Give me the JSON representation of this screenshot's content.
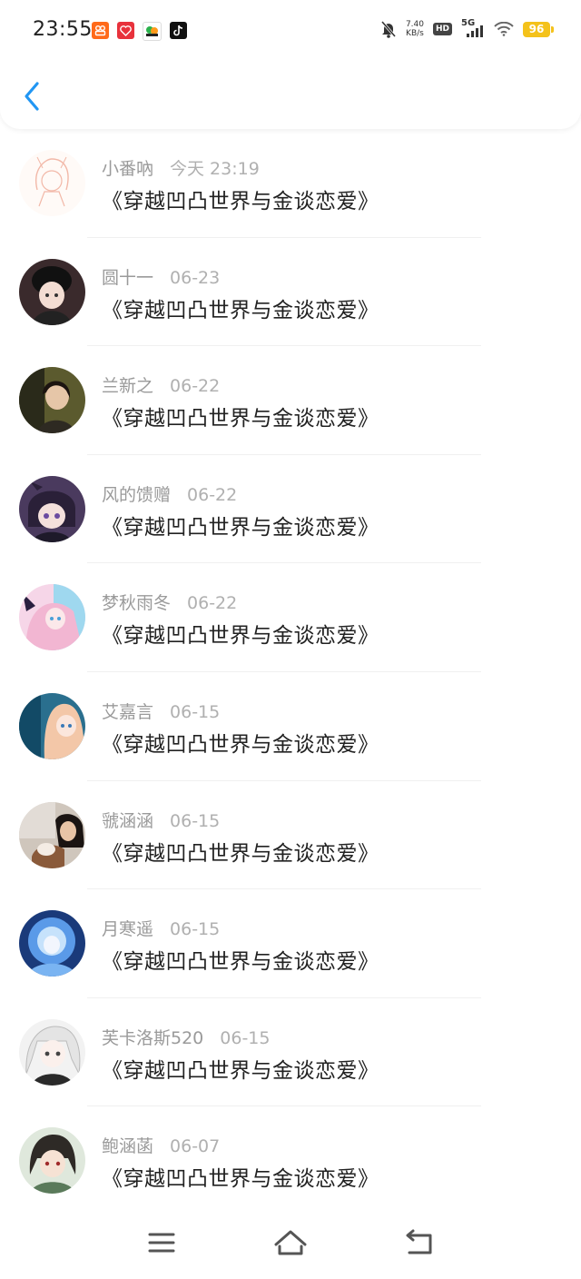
{
  "status_bar": {
    "time": "23:55",
    "net_speed_value": "7.40",
    "net_speed_unit": "KB/s",
    "hd": "HD",
    "network": "5G",
    "battery": "96"
  },
  "colors": {
    "accent": "#2196f3",
    "battery": "#f4c21b"
  },
  "messages": [
    {
      "name": "小番吶",
      "date": "今天 23:19",
      "text": "《穿越凹凸世界与金谈恋爱》"
    },
    {
      "name": "圆十一",
      "date": "06-23",
      "text": "《穿越凹凸世界与金谈恋爱》"
    },
    {
      "name": "兰新之",
      "date": "06-22",
      "text": "《穿越凹凸世界与金谈恋爱》"
    },
    {
      "name": "风的馈赠",
      "date": "06-22",
      "text": "《穿越凹凸世界与金谈恋爱》"
    },
    {
      "name": "梦秋雨冬",
      "date": "06-22",
      "text": "《穿越凹凸世界与金谈恋爱》"
    },
    {
      "name": "艾嘉言",
      "date": "06-15",
      "text": "《穿越凹凸世界与金谈恋爱》"
    },
    {
      "name": "虢涵涵",
      "date": "06-15",
      "text": "《穿越凹凸世界与金谈恋爱》"
    },
    {
      "name": "月寒遥",
      "date": "06-15",
      "text": "《穿越凹凸世界与金谈恋爱》"
    },
    {
      "name": "芙卡洛斯520",
      "date": "06-15",
      "text": "《穿越凹凸世界与金谈恋爱》"
    },
    {
      "name": "鲍涵菡",
      "date": "06-07",
      "text": "《穿越凹凸世界与金谈恋爱》"
    }
  ],
  "nav": {
    "menu_icon": "menu-icon",
    "home_icon": "home-icon",
    "back_icon": "back-icon"
  }
}
